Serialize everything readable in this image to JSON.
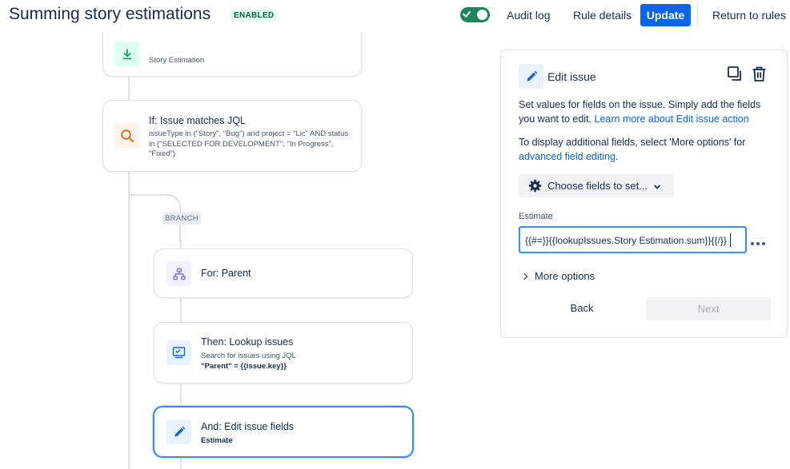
{
  "header": {
    "title": "Summing story estimations",
    "status_badge": "ENABLED",
    "toggle_on": true,
    "audit_log": "Audit log",
    "rule_details": "Rule details",
    "update": "Update",
    "return_to_rules": "Return to rules"
  },
  "flow": {
    "trigger": {
      "subtitle": "Story Estimation"
    },
    "condition": {
      "title": "If: Issue matches JQL",
      "jql": "issueType in (\"Story\", \"Bug\") and project = \"Lic\" AND status in (\"SELECTED FOR DEVELOPMENT\", \"In Progress\", \"Fixed\")"
    },
    "branch_label": "BRANCH",
    "branch_for": {
      "title": "For: Parent"
    },
    "lookup": {
      "title": "Then: Lookup issues",
      "subtitle": "Search for issues using JQL",
      "jql_key": "\"Parent\"",
      "jql_rest": " = {{issue.key}}"
    },
    "edit": {
      "title": "And: Edit issue fields",
      "subtitle": "Estimate"
    }
  },
  "panel": {
    "title": "Edit issue",
    "desc_1": "Set values for fields on the issue. Simply add the fields you want to edit. ",
    "desc_1_link": "Learn more about Edit issue action",
    "desc_2": "To display additional fields, select 'More options' for ",
    "desc_2_link": "advanced field editing",
    "desc_2_end": ".",
    "choose_fields": "Choose fields to set...",
    "field_label": "Estimate",
    "field_value": "{{#=}}{{lookupIssues.Story Estimation.sum}}{{/}}",
    "more_options": "More options",
    "back": "Back",
    "next": "Next"
  },
  "colors": {
    "primary": "#0c66e4",
    "toggle_on": "#1f845a",
    "badge_bg": "#e3fcef",
    "badge_text": "#006644",
    "selected_border": "#388bff",
    "trigger_icon": "#22a06b",
    "condition_icon": "#e56910",
    "branch_icon": "#8270db",
    "action_icon": "#0c66e4"
  },
  "icons": {
    "trigger": "download-icon",
    "condition": "search-icon",
    "branch": "hierarchy-icon",
    "lookup": "monitor-list-icon",
    "edit": "pencil-icon",
    "duplicate": "copy-icon",
    "delete": "trash-icon",
    "choose_fields": "gear-icon"
  }
}
